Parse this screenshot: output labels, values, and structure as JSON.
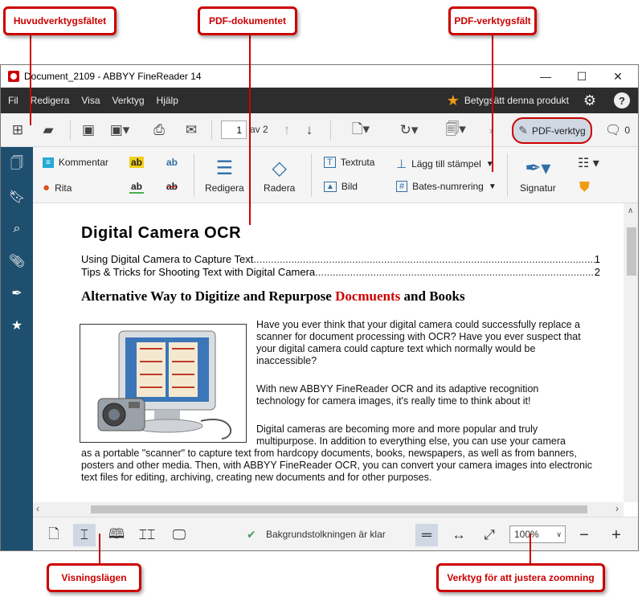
{
  "callouts": {
    "main_toolbar": "Huvudverktygsfältet",
    "pdf_document": "PDF-dokumentet",
    "pdf_toolbar": "PDF-verktygsfält",
    "view_modes": "Visningslägen",
    "zoom_tools": "Verktyg för att justera zoomning"
  },
  "window": {
    "title": "Document_2109 - ABBYY FineReader 14",
    "controls": {
      "minimize": "—",
      "maximize": "☐",
      "close": "✕"
    }
  },
  "menu": {
    "items": [
      "Fil",
      "Redigera",
      "Visa",
      "Verktyg",
      "Hjälp"
    ],
    "rate_label": "Betygsätt denna produkt"
  },
  "toolbar": {
    "page_current": "1",
    "page_total": "av 2",
    "pdf_tools_label": "PDF-verktyg",
    "comments_count": "0"
  },
  "pdf_toolbar": {
    "comment": "Kommentar",
    "draw": "Rita",
    "highlight_sample": "ab",
    "edit": "Redigera",
    "erase": "Radera",
    "textbox": "Textruta",
    "image": "Bild",
    "add_stamp": "Lägg till stämpel",
    "bates": "Bates-numrering",
    "signature": "Signatur"
  },
  "document": {
    "title": "Digital Camera OCR",
    "toc": [
      {
        "text": "Using Digital Camera to Capture Text",
        "page": "1"
      },
      {
        "text": "Tips & Tricks for Shooting Text with Digital Camera",
        "page": "2"
      }
    ],
    "heading_pre": "Alternative Way to Digitize and Repurpose ",
    "heading_red": "Docmuents",
    "heading_post": " and Books",
    "p1": "Have you ever think that your digital camera could successfully replace a scanner for document processing with OCR? Have you ever suspect that your digital camera could capture text which normally would be inaccessible?",
    "p2": "With new ABBYY FineReader OCR and its adaptive recognition technology  for camera images, it's really time to think about it!",
    "p3a": "Digital cameras are becoming more and more popular and truly multipurpose. In addition to everything else, you can use your camera",
    "p3b": "as a portable \"scanner\" to capture text from hardcopy documents, books, newspapers, as well as from banners, posters and other media. Then, with ABBYY FineReader OCR, you can convert your camera images into electronic text files for editing, archiving, creating new documents and for other purposes."
  },
  "status": {
    "background_text": "Bakgrundstolkningen är klar",
    "zoom": "100%"
  },
  "colors": {
    "accent": "#cc0000",
    "sidebar": "#1f4f6e",
    "menubar": "#2d2d2d"
  }
}
